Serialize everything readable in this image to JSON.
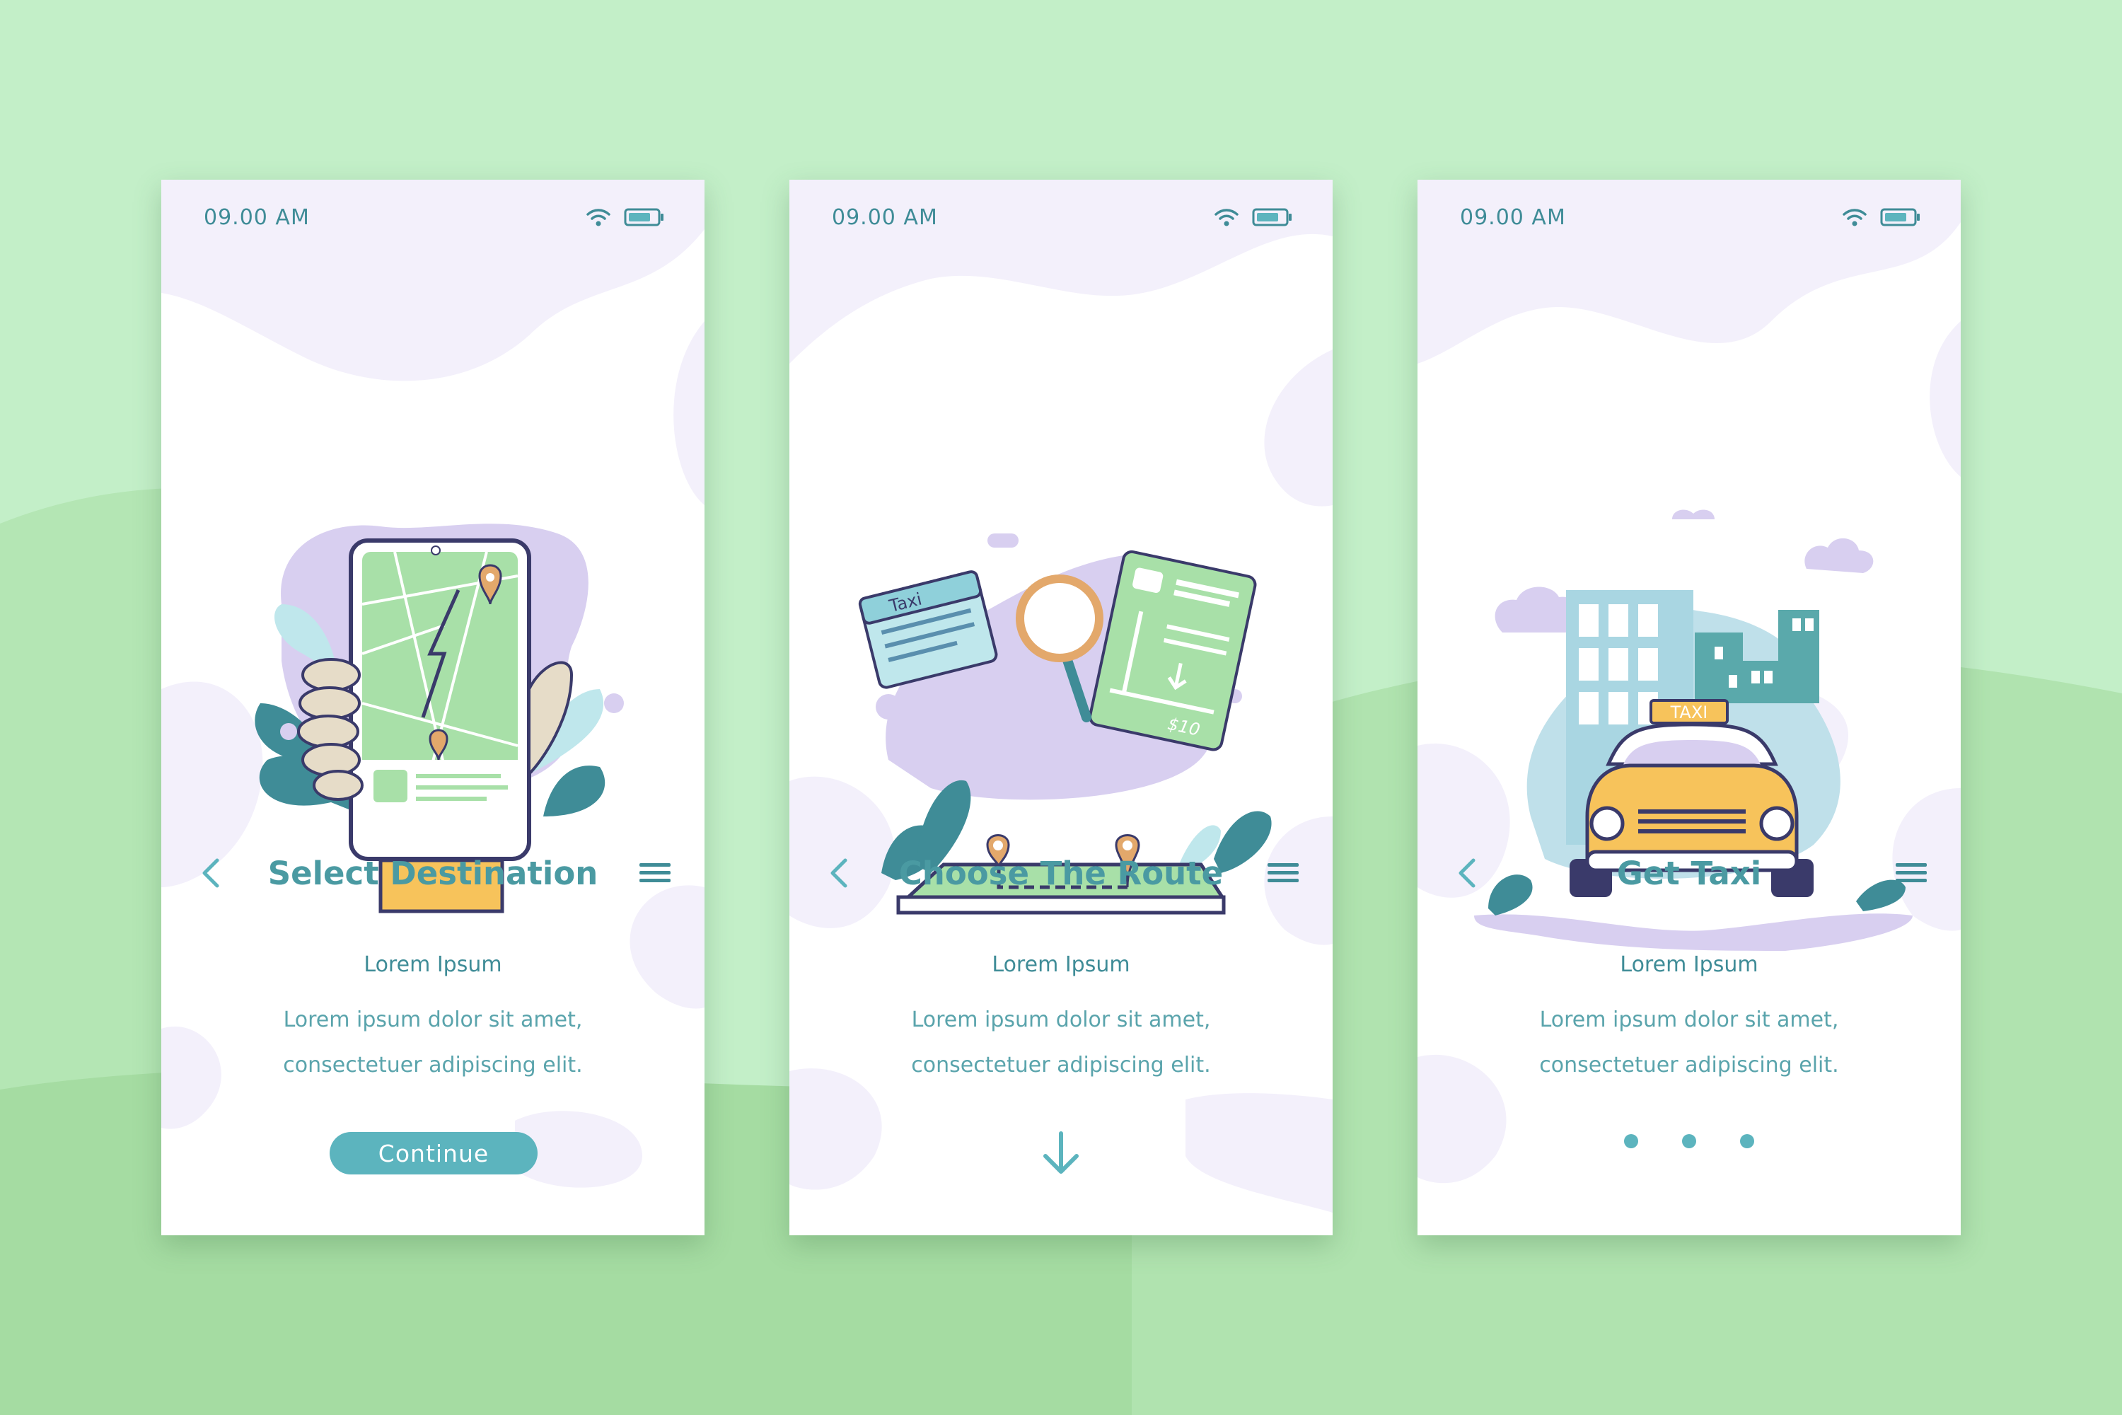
{
  "colors": {
    "background": "#c3efc8",
    "hill": "#9ed69b",
    "accent": "#5cb4be",
    "title": "#4a9aa2",
    "blob": "#f3f0fb",
    "lavender": "#d8cff0",
    "taxi_yellow": "#f7c35b"
  },
  "screens": [
    {
      "status": {
        "time": "09.00 AM",
        "icons": [
          "wifi-icon",
          "battery-icon"
        ]
      },
      "illustration": "hand-holding-phone-map",
      "nav": {
        "back_icon": "chevron-left-icon",
        "title": "Select Destination",
        "menu_icon": "hamburger-menu-icon"
      },
      "subtitle": "Lorem Ipsum",
      "body_line1": "Lorem ipsum dolor sit amet,",
      "body_line2": "consectetuer adipiscing elit.",
      "action": {
        "type": "button",
        "label": "Continue"
      }
    },
    {
      "status": {
        "time": "09.00 AM",
        "icons": [
          "wifi-icon",
          "battery-icon"
        ]
      },
      "illustration": "route-planning-map",
      "illustration_text": {
        "card_label": "Taxi",
        "price": "$10"
      },
      "nav": {
        "back_icon": "chevron-left-icon",
        "title": "Choose The Route",
        "menu_icon": "hamburger-menu-icon"
      },
      "subtitle": "Lorem Ipsum",
      "body_line1": "Lorem ipsum dolor sit amet,",
      "body_line2": "consectetuer adipiscing elit.",
      "action": {
        "type": "icon",
        "icon": "arrow-down-icon"
      }
    },
    {
      "status": {
        "time": "09.00 AM",
        "icons": [
          "wifi-icon",
          "battery-icon"
        ]
      },
      "illustration": "taxi-in-city",
      "illustration_text": {
        "roof_sign": "TAXI"
      },
      "nav": {
        "back_icon": "chevron-left-icon",
        "title": "Get Taxi",
        "menu_icon": "hamburger-menu-icon"
      },
      "subtitle": "Lorem Ipsum",
      "body_line1": "Lorem ipsum dolor sit amet,",
      "body_line2": "consectetuer adipiscing elit.",
      "action": {
        "type": "pagination",
        "count": 3
      }
    }
  ]
}
